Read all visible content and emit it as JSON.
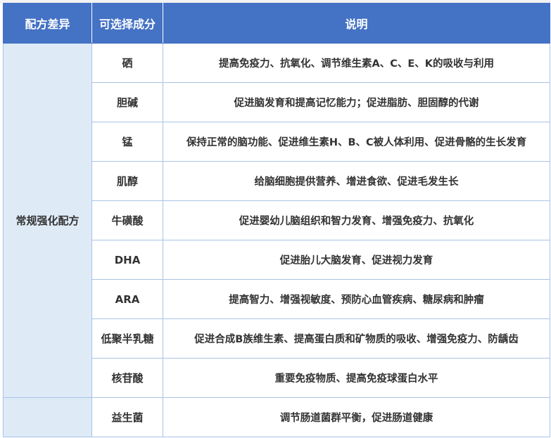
{
  "headers": [
    "配方差异",
    "可选择成分",
    "说明"
  ],
  "groups": [
    {
      "name": "常规强化配方",
      "rows": [
        {
          "ingredient": "硒",
          "description": "提高免疫力、抗氧化、调节维生素A、C、E、K的吸收与利用"
        },
        {
          "ingredient": "胆碱",
          "description": "促进脑发育和提高记忆能力；促进脂肪、胆固醇的代谢"
        },
        {
          "ingredient": "锰",
          "description": "保持正常的脑功能、促进维生素H、B、C被人体利用、促进骨骼的生长发育"
        },
        {
          "ingredient": "肌醇",
          "description": "给脑细胞提供营养、增进食欲、促进毛发生长"
        },
        {
          "ingredient": "牛磺酸",
          "description": "促进婴幼儿脑组织和智力发育、增强免疫力、抗氧化"
        },
        {
          "ingredient": "DHA",
          "description": "促进胎儿大脑发育、促进视力发育"
        },
        {
          "ingredient": "ARA",
          "description": "提高智力、增强视敏度、预防心血管疾病、糖尿病和肿瘤"
        },
        {
          "ingredient": "低聚半乳糖",
          "description": "促进合成B族维生素、提高蛋白质和矿物质的吸收、增强免疫力、防龋齿"
        },
        {
          "ingredient": "核苷酸",
          "description": "重要免疫物质、提高免疫球蛋白水平"
        }
      ]
    },
    {
      "name": "",
      "rows": [
        {
          "ingredient": "益生菌",
          "description": "调节肠道菌群平衡，促进肠道健康"
        }
      ]
    }
  ]
}
